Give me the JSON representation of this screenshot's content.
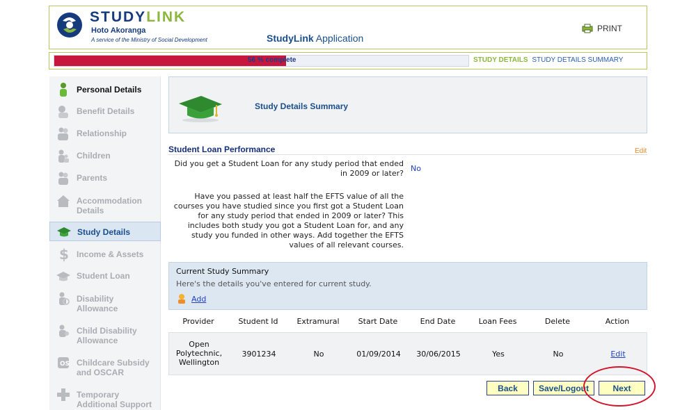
{
  "header": {
    "logo_study": "STUDY",
    "logo_link": "LINK",
    "logo_sub": "Hoto Akoranga",
    "logo_service": "A service of the Ministry of Social Development",
    "app_title_bold": "StudyLink",
    "app_title_rest": "Application",
    "print_label": "PRINT"
  },
  "progress": {
    "percent": 56,
    "label": "56 % complete",
    "current_crumb": "STUDY DETAILS",
    "next_crumb": "STUDY DETAILS SUMMARY"
  },
  "sidebar": {
    "items": [
      {
        "label": "Personal Details",
        "icon": "person-icon"
      },
      {
        "label": "Benefit Details",
        "icon": "benefit-icon"
      },
      {
        "label": "Relationship",
        "icon": "relationship-icon"
      },
      {
        "label": "Children",
        "icon": "children-icon"
      },
      {
        "label": "Parents",
        "icon": "parents-icon"
      },
      {
        "label_line1": "Accommodation",
        "label_line2": "Details",
        "icon": "house-icon"
      },
      {
        "label": "Study Details",
        "icon": "graduation-cap-icon"
      },
      {
        "label": "Income & Assets",
        "icon": "dollar-icon"
      },
      {
        "label": "Student Loan",
        "icon": "student-loan-icon"
      },
      {
        "label_line1": "Disability",
        "label_line2": "Allowance",
        "icon": "disability-icon"
      },
      {
        "label_line1": "Child Disability",
        "label_line2": "Allowance",
        "icon": "child-disability-icon"
      },
      {
        "label_line1": "Childcare Subsidy",
        "label_line2": "and OSCAR",
        "icon": "childcare-icon"
      },
      {
        "label_line1": "Temporary",
        "label_line2": "Additional Support",
        "icon": "plus-icon"
      }
    ]
  },
  "main": {
    "summary_title": "Study Details Summary",
    "section_title": "Student Loan Performance",
    "edit_label": "Edit",
    "q1_line1": "Did you get a Student Loan for any study period that ended",
    "q1_line2": "in 2009 or later?",
    "q1_answer": "No",
    "q2_lines": [
      "Have you passed at least half the EFTS value of all the",
      "courses you have studied since you first got a Student Loan",
      "for any study period that ended in 2009 or later? This",
      "includes both study you got a Student Loan for, and any",
      "study you funded in other ways. Add together the EFTS",
      "values of all relevant courses."
    ],
    "current_study": {
      "title": "Current Study Summary",
      "subtitle": "Here's the details you've entered for current study.",
      "add_label": "Add"
    },
    "table": {
      "headers": [
        "Provider",
        "Student Id",
        "Extramural",
        "Start Date",
        "End Date",
        "Loan Fees",
        "Delete",
        "Action"
      ],
      "row": {
        "provider_lines": [
          "Open",
          "Polytechnic,",
          "Wellington"
        ],
        "student_id": "3901234",
        "extramural": "No",
        "start_date": "01/09/2014",
        "end_date": "30/06/2015",
        "loan_fees": "Yes",
        "delete": "No",
        "action": "Edit"
      }
    }
  },
  "buttons": {
    "back": "Back",
    "save_logout": "Save/Logout",
    "next": "Next"
  },
  "colors": {
    "progress_fill": "#c8173d",
    "brand_blue": "#163b7d",
    "brand_green": "#8cb63c",
    "button_bg": "#ffffc2",
    "highlight_circle": "#d2152b"
  }
}
